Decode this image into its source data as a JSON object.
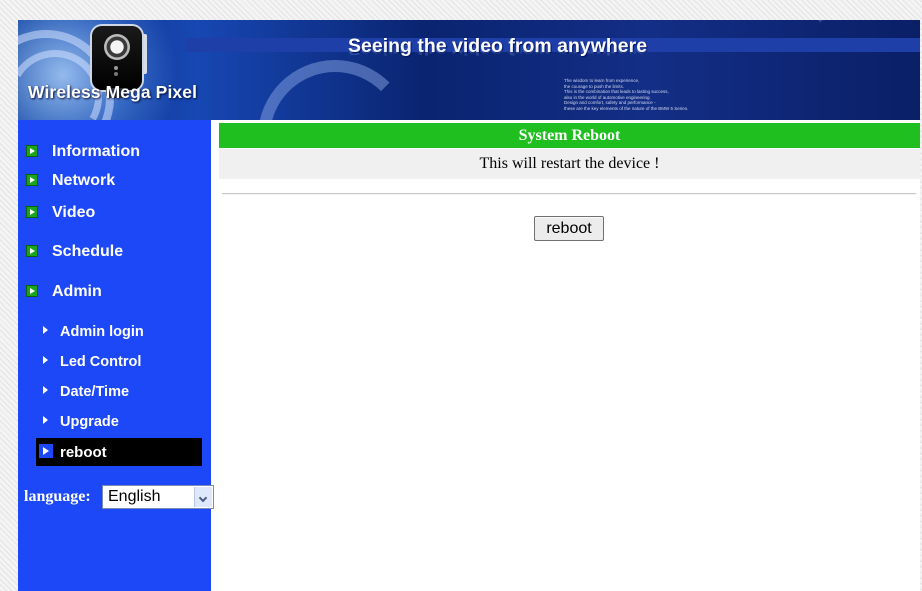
{
  "header": {
    "brand": "Wireless Mega Pixel",
    "slogan": "Seeing the video from anywhere",
    "fine_print": [
      "The wisdom to learn from experience,",
      "the courage to push the limits.",
      "This is the combination that leads to lasting success,",
      "also in the world of automotive engineering.",
      "Design and comfort, safety and performance -",
      "these are the key elements of the nature of the BMW 5 Series."
    ]
  },
  "sidebar": {
    "items": [
      {
        "label": "Information",
        "icon": "green-arrow-bullet-icon"
      },
      {
        "label": "Network",
        "icon": "green-arrow-bullet-icon"
      },
      {
        "label": "Video",
        "icon": "green-arrow-bullet-icon"
      },
      {
        "label": "Schedule",
        "icon": "green-arrow-bullet-icon"
      },
      {
        "label": "Admin",
        "icon": "green-arrow-bullet-icon"
      }
    ],
    "admin_sub": [
      {
        "label": "Admin login"
      },
      {
        "label": "Led Control"
      },
      {
        "label": "Date/Time"
      },
      {
        "label": "Upgrade"
      },
      {
        "label": "reboot",
        "active": true
      }
    ],
    "language": {
      "label": "language:",
      "selected": "English"
    }
  },
  "main": {
    "section_title": "System Reboot",
    "message": "This will restart the device !",
    "button_label": "reboot"
  },
  "colors": {
    "sidebar_bg": "#1d48f7",
    "header_bar": "#1fbf1f",
    "message_bg": "#f0f0f0",
    "active_item_bg": "#000000"
  }
}
